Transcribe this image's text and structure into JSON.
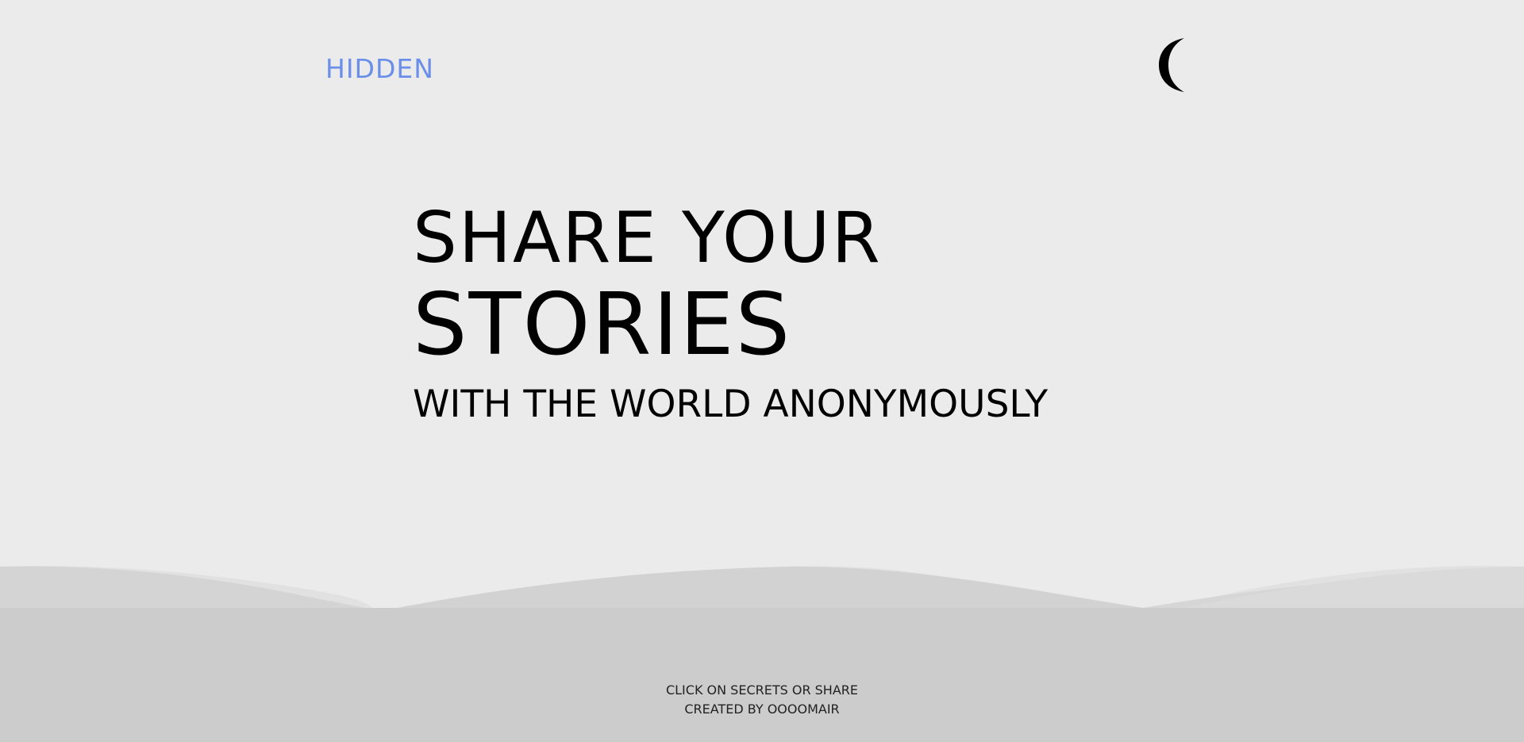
{
  "header": {
    "logo_text": "HIDDEN",
    "theme_toggle_icon": "crescent-moon-icon"
  },
  "hero": {
    "line1": "SHARE YOUR",
    "line2": "STORIES",
    "subtitle": "WITH THE WORLD ANONYMOUSLY"
  },
  "footer": {
    "line1": "CLICK ON SECRETS OR SHARE",
    "line2": "CREATED BY OOOOMAIR"
  },
  "colors": {
    "background": "#ebebeb",
    "logo": "#6b8fe8",
    "footer_background": "#cccccc",
    "wave_light": "#dedede",
    "wave_mid": "#d6d6d6"
  }
}
